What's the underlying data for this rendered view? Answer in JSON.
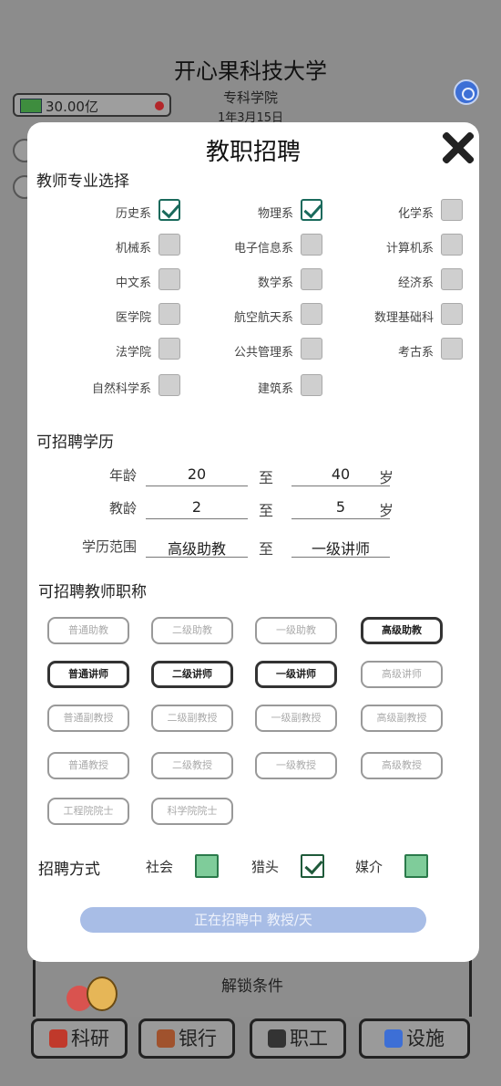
{
  "background": {
    "university_name": "开心果科技大学",
    "college": "专科学院",
    "date": "1年3月15日",
    "money": "30.00亿",
    "unlock_title": "解锁条件",
    "nav": [
      {
        "label": "科研",
        "icon": "flask-icon"
      },
      {
        "label": "银行",
        "icon": "bank-icon"
      },
      {
        "label": "职工",
        "icon": "graduation-cap-icon"
      },
      {
        "label": "设施",
        "icon": "building-icon"
      }
    ]
  },
  "modal": {
    "title": "教职招聘",
    "majors_heading": "教师专业选择",
    "majors": [
      {
        "label": "历史系",
        "checked": true
      },
      {
        "label": "物理系",
        "checked": true
      },
      {
        "label": "化学系",
        "checked": false
      },
      {
        "label": "机械系",
        "checked": false
      },
      {
        "label": "电子信息系",
        "checked": false
      },
      {
        "label": "计算机系",
        "checked": false
      },
      {
        "label": "中文系",
        "checked": false
      },
      {
        "label": "数学系",
        "checked": false
      },
      {
        "label": "经济系",
        "checked": false
      },
      {
        "label": "医学院",
        "checked": false
      },
      {
        "label": "航空航天系",
        "checked": false
      },
      {
        "label": "数理基础科",
        "checked": false
      },
      {
        "label": "法学院",
        "checked": false
      },
      {
        "label": "公共管理系",
        "checked": false
      },
      {
        "label": "考古系",
        "checked": false
      },
      {
        "label": "自然科学系",
        "checked": false
      },
      {
        "label": "建筑系",
        "checked": false
      }
    ],
    "requirements_heading": "可招聘学历",
    "requirements": [
      {
        "label": "年龄",
        "from": "20",
        "to_label": "至",
        "to": "40",
        "unit": "岁"
      },
      {
        "label": "教龄",
        "from": "2",
        "to_label": "至",
        "to": "5",
        "unit": "岁"
      },
      {
        "label": "学历范围",
        "from": "高级助教",
        "to_label": "至",
        "to": "一级讲师",
        "unit": ""
      }
    ],
    "titles_heading": "可招聘教师职称",
    "titles": [
      {
        "label": "普通助教",
        "selected": false
      },
      {
        "label": "二级助教",
        "selected": false
      },
      {
        "label": "一级助教",
        "selected": false
      },
      {
        "label": "高级助教",
        "selected": true
      },
      {
        "label": "普通讲师",
        "selected": true
      },
      {
        "label": "二级讲师",
        "selected": true
      },
      {
        "label": "一级讲师",
        "selected": true
      },
      {
        "label": "高级讲师",
        "selected": false
      },
      {
        "label": "普通副教授",
        "selected": false
      },
      {
        "label": "二级副教授",
        "selected": false
      },
      {
        "label": "一级副教授",
        "selected": false
      },
      {
        "label": "高级副教授",
        "selected": false
      },
      {
        "label": "普通教授",
        "selected": false
      },
      {
        "label": "二级教授",
        "selected": false
      },
      {
        "label": "一级教授",
        "selected": false
      },
      {
        "label": "高级教授",
        "selected": false
      },
      {
        "label": "工程院院士",
        "selected": false
      },
      {
        "label": "科学院院士",
        "selected": false
      }
    ],
    "method_heading": "招聘方式",
    "methods": [
      {
        "label": "社会",
        "checked": false
      },
      {
        "label": "猎头",
        "checked": true
      },
      {
        "label": "媒介",
        "checked": false
      }
    ],
    "status": "正在招聘中 教授/天"
  }
}
